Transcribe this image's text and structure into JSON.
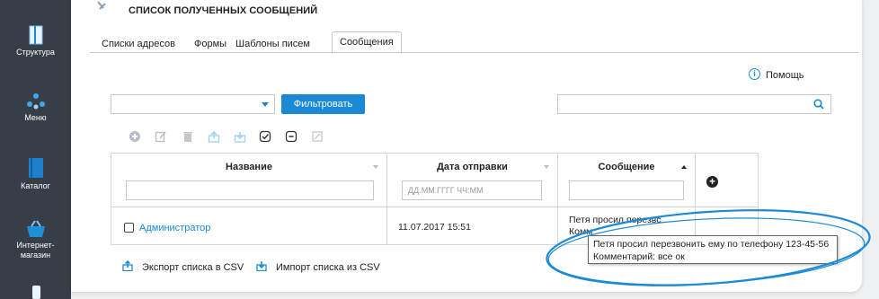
{
  "sidebar": {
    "items": [
      {
        "label": "Структура"
      },
      {
        "label": "Меню"
      },
      {
        "label": "Каталог"
      },
      {
        "label_line1": "Интернет-",
        "label_line2": "магазин"
      }
    ]
  },
  "page": {
    "title": "СПИСОК ПОЛУЧЕННЫХ СООБЩЕНИЙ"
  },
  "tabs": [
    {
      "label": "Списки адресов"
    },
    {
      "label": "Формы"
    },
    {
      "label": "Шаблоны писем"
    },
    {
      "label": "Сообщения",
      "active": true
    }
  ],
  "help": {
    "label": "Помощь",
    "icon": "info-icon"
  },
  "filter": {
    "select_value": "",
    "button_label": "Фильтровать"
  },
  "search": {
    "value": "",
    "icon": "search-icon"
  },
  "toolbar": {
    "icons": [
      "add-icon",
      "edit-icon",
      "delete-icon",
      "upload-icon",
      "download-icon",
      "check-all-icon",
      "uncheck-icon",
      "copy-icon"
    ]
  },
  "table": {
    "columns": [
      {
        "title": "Название",
        "filter_placeholder": ""
      },
      {
        "title": "Дата отправки",
        "filter_placeholder": "ДД.ММ.ГГГГ ЧЧ:ММ"
      },
      {
        "title": "Сообщение",
        "filter_placeholder": ""
      }
    ],
    "rows": [
      {
        "name": "Администратор",
        "date": "11.07.2017 15:51",
        "message_line1": "Петя просил перезвс",
        "message_line2": "Комм"
      }
    ]
  },
  "tooltip": {
    "line1": "Петя просил перезвонить ему по телефону 123-45-56",
    "line2": "Комментарий: все ок"
  },
  "actions": {
    "export_label": "Экспорт списка в CSV",
    "import_label": "Импорт списка из CSV"
  },
  "colors": {
    "accent": "#1a8ad6",
    "sidebar_bg": "#383e48",
    "annotation": "#1a8ad6"
  }
}
